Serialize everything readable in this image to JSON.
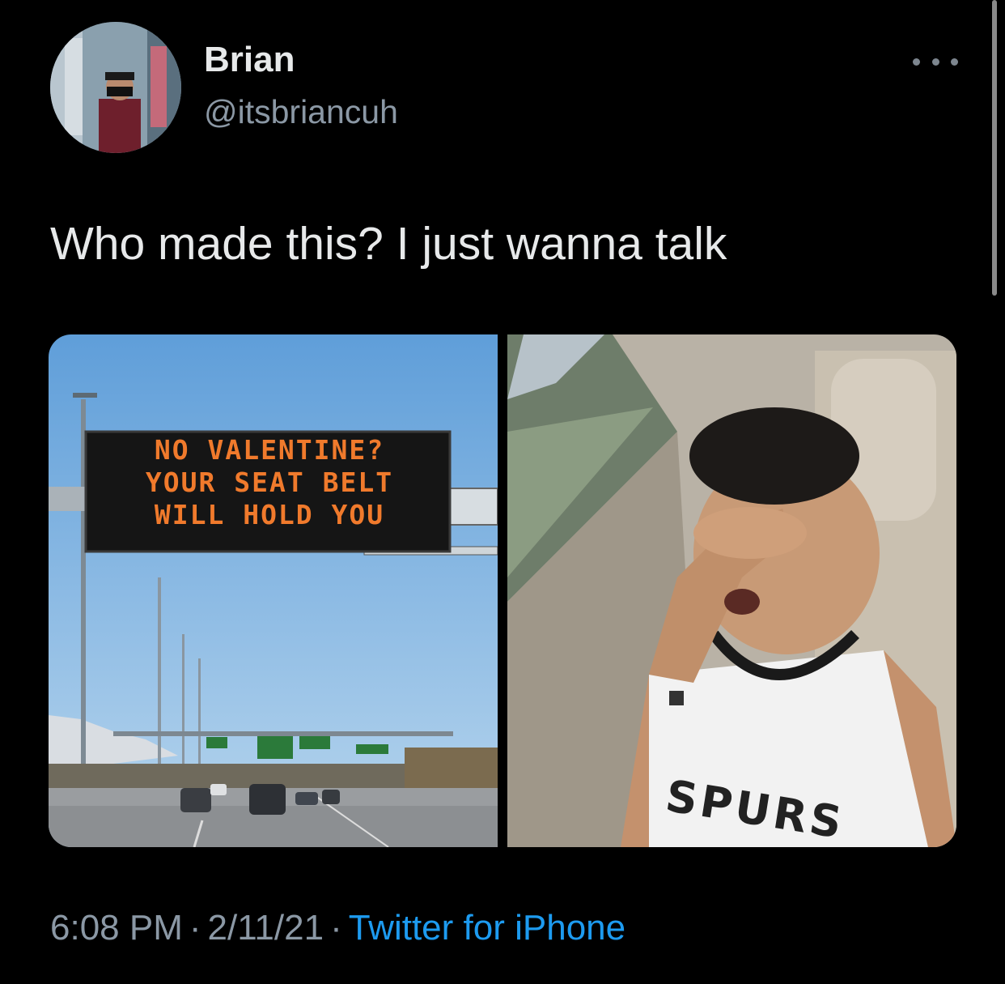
{
  "author": {
    "display_name": "Brian",
    "handle": "@itsbriancuh"
  },
  "tweet": {
    "text": "Who made this? I just wanna talk",
    "time": "6:08 PM",
    "date": "2/11/21",
    "separator": "·",
    "source": "Twitter for iPhone"
  },
  "media": {
    "left_image": {
      "sign_lines": [
        "NO VALENTINE?",
        "YOUR SEAT BELT",
        "WILL HOLD YOU"
      ]
    },
    "right_image": {
      "jersey_text": "SPURS"
    }
  },
  "icons": {
    "more": "more-horizontal-icon",
    "avatar": "profile-avatar"
  },
  "colors": {
    "background": "#000000",
    "primary_text": "#e7e9ea",
    "secondary_text": "#8b98a5",
    "link": "#1d9bf0",
    "sign_led": "#f07a2c"
  }
}
